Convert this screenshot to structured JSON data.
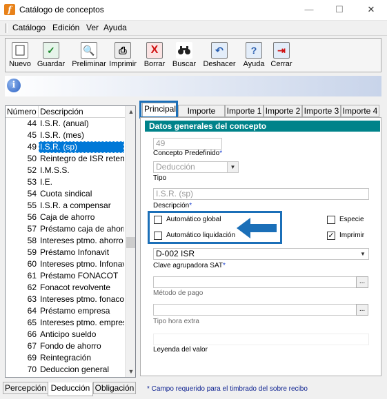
{
  "window": {
    "title": "Catálogo de conceptos",
    "app_icon": "f",
    "minimize": "—",
    "maximize": "☐",
    "close": "✕"
  },
  "menu": [
    "Catálogo",
    "Edición",
    "Ver",
    "Ayuda"
  ],
  "toolbar": [
    {
      "label": "Nuevo",
      "icon": "new-document-icon"
    },
    {
      "label": "Guardar",
      "icon": "checkmark-icon"
    },
    {
      "label": "Preliminar",
      "icon": "print-preview-icon"
    },
    {
      "label": "Imprimir",
      "icon": "printer-icon"
    },
    {
      "label": "Borrar",
      "icon": "delete-x-icon"
    },
    {
      "label": "Buscar",
      "icon": "binoculars-icon"
    },
    {
      "label": "Deshacer",
      "icon": "undo-icon"
    },
    {
      "label": "Ayuda",
      "icon": "help-icon"
    },
    {
      "label": "Cerrar",
      "icon": "exit-door-icon"
    }
  ],
  "info_icon": "i",
  "list": {
    "headers": [
      "Número",
      "Descripción"
    ],
    "rows": [
      {
        "num": "44",
        "desc": "I.S.R. (anual)"
      },
      {
        "num": "45",
        "desc": "I.S.R. (mes)"
      },
      {
        "num": "49",
        "desc": "I.S.R. (sp)",
        "selected": true
      },
      {
        "num": "50",
        "desc": "Reintegro de ISR retenido"
      },
      {
        "num": "52",
        "desc": "I.M.S.S."
      },
      {
        "num": "53",
        "desc": "I.E."
      },
      {
        "num": "54",
        "desc": "Cuota sindical"
      },
      {
        "num": "55",
        "desc": "I.S.R. a compensar"
      },
      {
        "num": "56",
        "desc": "Caja de ahorro"
      },
      {
        "num": "57",
        "desc": "Préstamo caja de ahorro"
      },
      {
        "num": "58",
        "desc": "Intereses ptmo. ahorro"
      },
      {
        "num": "59",
        "desc": "Préstamo Infonavit"
      },
      {
        "num": "60",
        "desc": "Intereses ptmo. Infonavit"
      },
      {
        "num": "61",
        "desc": "Préstamo FONACOT"
      },
      {
        "num": "62",
        "desc": "Fonacot revolvente"
      },
      {
        "num": "63",
        "desc": "Intereses ptmo. fonacot"
      },
      {
        "num": "64",
        "desc": "Préstamo empresa"
      },
      {
        "num": "65",
        "desc": "Intereses ptmo. empresa"
      },
      {
        "num": "66",
        "desc": "Anticipo sueldo"
      },
      {
        "num": "67",
        "desc": "Fondo de ahorro"
      },
      {
        "num": "69",
        "desc": "Reintegración"
      },
      {
        "num": "70",
        "desc": "Deduccion general"
      }
    ]
  },
  "left_tabs": [
    "Percepción",
    "Deducción",
    "Obligación"
  ],
  "right_tabs": [
    "Principal",
    "Importe total",
    "Importe 1",
    "Importe 2",
    "Importe 3",
    "Importe 4"
  ],
  "section_title": "Datos generales del concepto",
  "form": {
    "numero_value": "49",
    "concepto_label": "Concepto Predefinido",
    "tipo_value": "Deducción",
    "tipo_label": "Tipo",
    "descripcion_value": "I.S.R. (sp)",
    "descripcion_label": "Descripción",
    "required_mark": "*",
    "auto_global_label": "Automático global",
    "auto_global_checked": false,
    "auto_liq_label": "Automático liquidación",
    "auto_liq_checked": false,
    "especie_label": "Especie",
    "especie_checked": false,
    "imprimir_label": "Imprimir",
    "imprimir_checked": true,
    "clave_value": "D-002  ISR",
    "clave_label": "Clave agrupadora SAT",
    "metodo_label": "Método de pago",
    "tipo_hora_label": "Tipo hora extra",
    "leyenda_label": "Leyenda del valor",
    "ellipsis": "..."
  },
  "status_text": "* Campo requerido para el timbrado del sobre recibo",
  "colors": {
    "section_bar": "#00838a",
    "highlight": "#1b6fb8",
    "selection": "#0078d7",
    "required": "#1a3fd0"
  }
}
